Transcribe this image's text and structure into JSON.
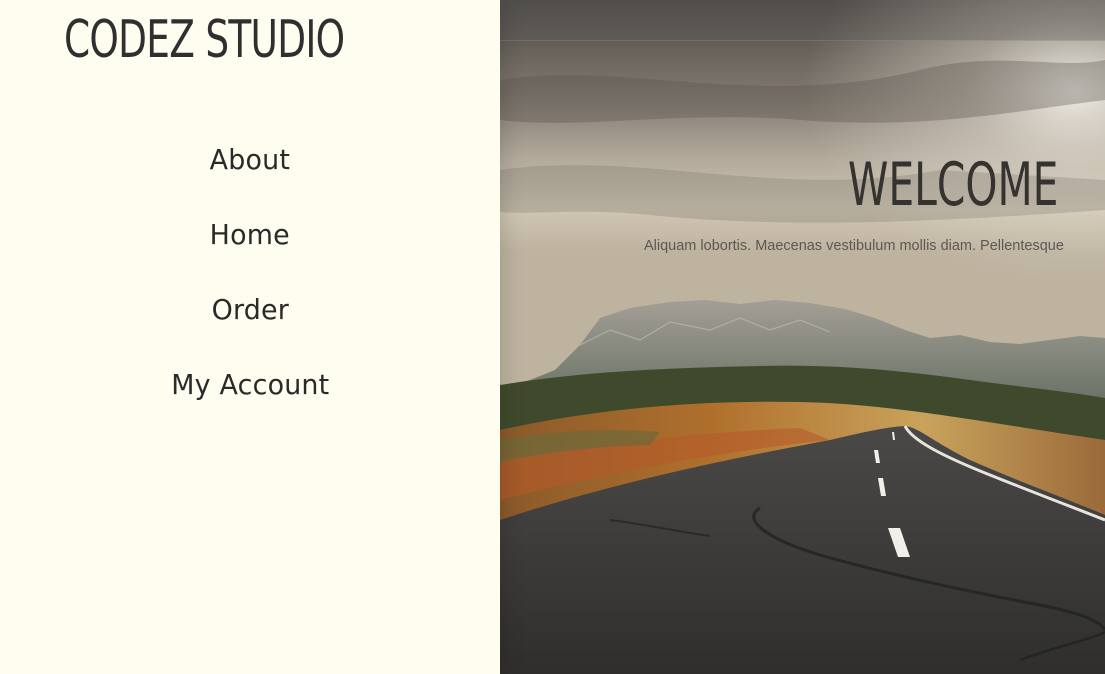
{
  "brand": {
    "name": "CODEZ STUDIO"
  },
  "nav": {
    "items": [
      {
        "label": "About"
      },
      {
        "label": "Home"
      },
      {
        "label": "Order"
      },
      {
        "label": "My Account"
      }
    ]
  },
  "hero": {
    "heading": "WELCOME",
    "tagline": "Aliquam lobortis. Maecenas vestibulum mollis diam. Pellentesque"
  },
  "colors": {
    "sidebar_bg": "#fffdf0",
    "text": "#2f2f2f",
    "hero_heading": "#353330"
  }
}
